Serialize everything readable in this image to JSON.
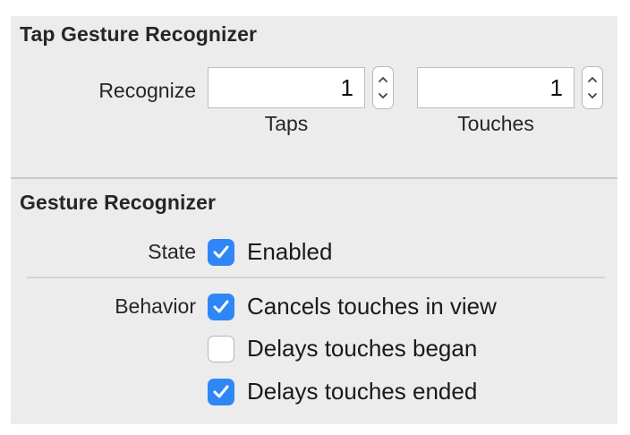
{
  "tap_section": {
    "title": "Tap Gesture Recognizer",
    "recognize_label": "Recognize",
    "taps": {
      "value": "1",
      "label": "Taps"
    },
    "touches": {
      "value": "1",
      "label": "Touches"
    }
  },
  "gesture_section": {
    "title": "Gesture Recognizer",
    "state_label": "State",
    "enabled": {
      "label": "Enabled",
      "checked": true
    },
    "behavior_label": "Behavior",
    "behaviors": [
      {
        "label": "Cancels touches in view",
        "checked": true
      },
      {
        "label": "Delays touches began",
        "checked": false
      },
      {
        "label": "Delays touches ended",
        "checked": true
      }
    ]
  },
  "colors": {
    "checkbox_accent": "#2f86f6",
    "panel_bg": "#ececec"
  }
}
